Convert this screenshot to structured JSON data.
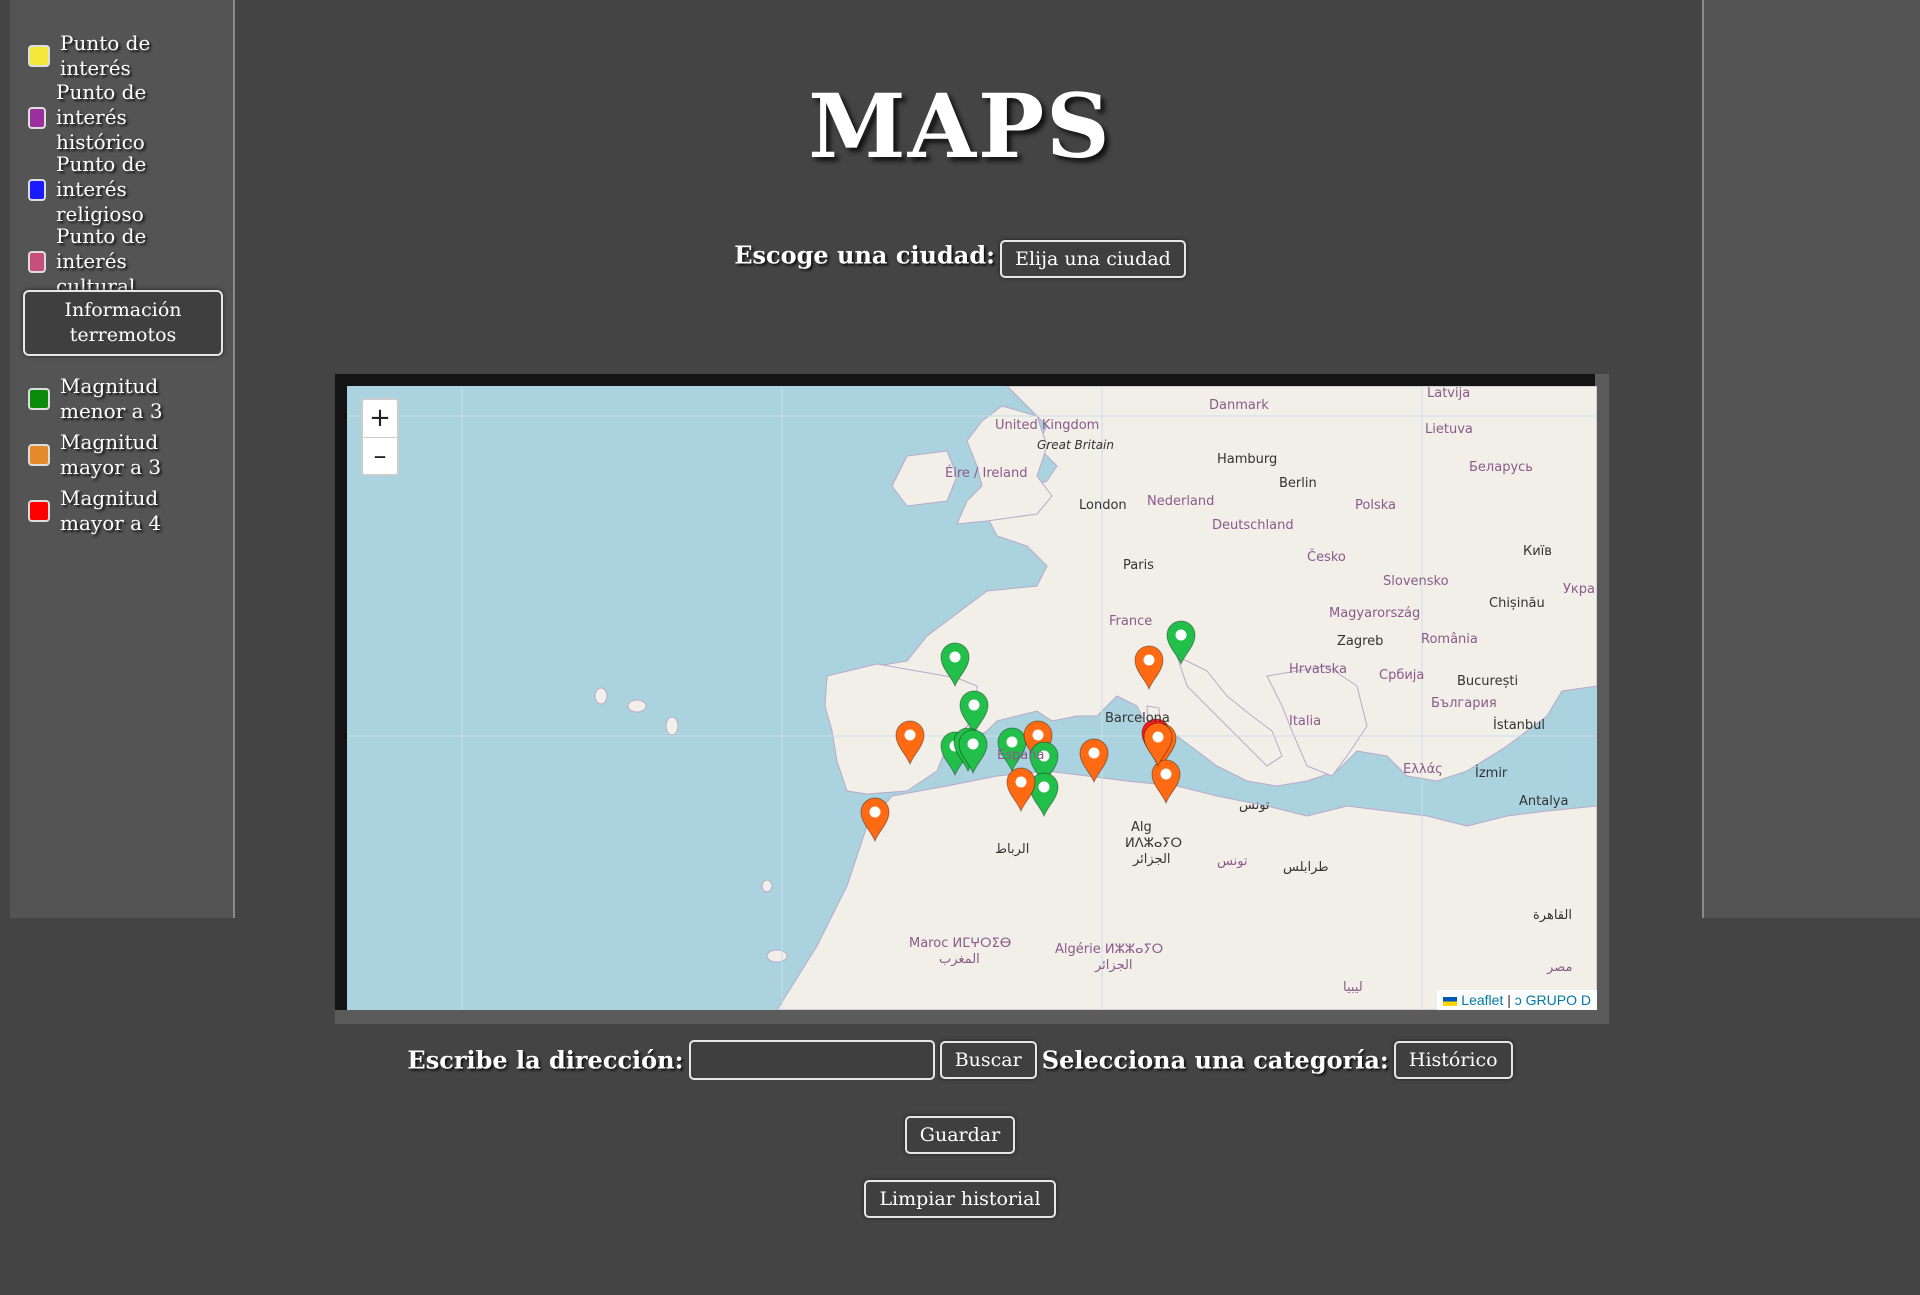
{
  "legend": {
    "items": [
      {
        "label": "Punto de interés",
        "color": "#f5e83a"
      },
      {
        "label": "Punto de interés histórico",
        "color": "#9b2f9e"
      },
      {
        "label": "Punto de interés religioso",
        "color": "#1a1aff"
      },
      {
        "label": "Punto de interés cultural",
        "color": "#c5517a"
      }
    ],
    "earthquake_button": "Información terremotos",
    "magnitudes": [
      {
        "label": "Magnitud menor a 3",
        "color": "#0a8c0a"
      },
      {
        "label": "Magnitud mayor a 3",
        "color": "#e58a2a"
      },
      {
        "label": "Magnitud mayor a 4",
        "color": "#ff0000"
      }
    ]
  },
  "header": {
    "title": "MAPS"
  },
  "city": {
    "label": "Escoge una ciudad:",
    "select_value": "Elija una ciudad"
  },
  "map": {
    "zoom_in": "+",
    "zoom_out": "–",
    "attribution_leaflet": "Leaflet",
    "attribution_sep": "|",
    "attribution_group": "ↄ GRUPO D",
    "labels": {
      "uk": "United Kingdom",
      "gb": "Great Britain",
      "ireland": "Éire / Ireland",
      "london": "London",
      "hamburg": "Hamburg",
      "berlin": "Berlin",
      "nederland": "Nederland",
      "deutschland": "Deutschland",
      "polska": "Polska",
      "danmark": "Danmark",
      "latvija": "Latvija",
      "lietuva": "Lietuva",
      "belarus": "Беларусь",
      "paris": "Paris",
      "france": "France",
      "cesko": "Česko",
      "slovensko": "Slovensko",
      "magyarorszag": "Magyarország",
      "kyiv": "Київ",
      "ukra": "Укра",
      "chisinau": "Chișinău",
      "zagreb": "Zagreb",
      "romania": "România",
      "hrvatska": "Hrvatska",
      "srbija": "Србија",
      "bucuresti": "București",
      "bulgaria": "България",
      "barcelona": "Barcelona",
      "italia": "Italia",
      "istanbul": "İstanbul",
      "espana": "España",
      "ellas": "Ελλάς",
      "izmir": "İzmir",
      "antalya": "Antalya",
      "tunis": "تونس",
      "tunis2": "تونس",
      "tarabulus": "طرابلس",
      "maroc": "Maroc ⵍⵎⵖⵔⵉⴱ",
      "maghrib": "المغرب",
      "algerie": "Algérie ⵍⵣⵣⴰⵢⵔ",
      "jazair": "الجزائر",
      "jazair2": "الجزائر",
      "alger": "Alg",
      "alger_tif": "ⵍⴷⵣⴰⵢⵔ",
      "ribat": "الرباط",
      "libya": "ليبيا",
      "cairo": "القاهرة",
      "misr": "مصر"
    },
    "markers": [
      {
        "magnitude_class": "menor a 3"
      },
      {
        "magnitude_class": "menor a 3"
      },
      {
        "magnitude_class": "mayor a 3"
      },
      {
        "magnitude_class": "mayor a 3"
      },
      {
        "magnitude_class": "menor a 3"
      },
      {
        "magnitude_class": "menor a 3"
      },
      {
        "magnitude_class": "menor a 3"
      },
      {
        "magnitude_class": "menor a 3"
      },
      {
        "magnitude_class": "mayor a 3"
      },
      {
        "magnitude_class": "menor a 3"
      },
      {
        "magnitude_class": "menor a 3"
      },
      {
        "magnitude_class": "mayor a 3"
      },
      {
        "magnitude_class": "mayor a 3"
      },
      {
        "magnitude_class": "mayor a 3"
      },
      {
        "magnitude_class": "mayor a 4"
      },
      {
        "magnitude_class": "mayor a 3"
      },
      {
        "magnitude_class": "mayor a 3"
      },
      {
        "magnitude_class": "menor a 3"
      },
      {
        "magnitude_class": "mayor a 3"
      }
    ]
  },
  "search": {
    "address_label": "Escribe la dirección:",
    "address_value": "",
    "search_button": "Buscar",
    "category_label": "Selecciona una categoría:",
    "category_value": "Histórico"
  },
  "actions": {
    "save": "Guardar",
    "clear_history": "Limpiar historial"
  }
}
